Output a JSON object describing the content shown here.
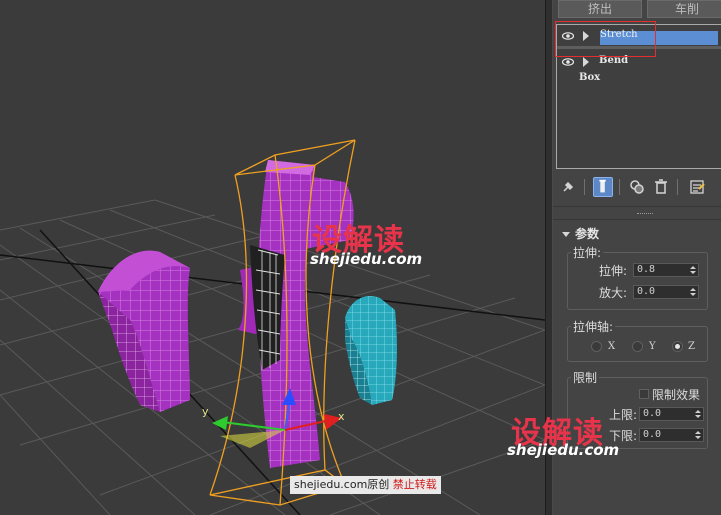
{
  "top_buttons": {
    "extrude": "挤出",
    "lathe": "车削"
  },
  "modifier_stack": {
    "items": [
      {
        "name": "Stretch",
        "selected": true,
        "has_eye": true,
        "has_arrow": true
      },
      {
        "name": "Bend",
        "selected": false,
        "has_eye": true,
        "has_arrow": true
      },
      {
        "name": "Box",
        "selected": false,
        "has_eye": false,
        "has_arrow": false
      }
    ]
  },
  "toolbar": {
    "icons": [
      "pin-stack-icon",
      "show-end-result-icon",
      "make-unique-icon",
      "remove-modifier-icon",
      "configure-modifier-sets-icon"
    ]
  },
  "parameters": {
    "title": "参数",
    "stretch_group": {
      "label": "拉伸:",
      "stretch_label": "拉伸:",
      "stretch_value": "0.8",
      "amplify_label": "放大:",
      "amplify_value": "0.0"
    },
    "axis_group": {
      "label": "拉伸轴:",
      "options": [
        "X",
        "Y",
        "Z"
      ],
      "selected": "Z"
    },
    "limit_group": {
      "label": "限制",
      "limit_effect_label": "限制效果",
      "limit_effect_checked": false,
      "upper_label": "上限:",
      "upper_value": "0.0",
      "lower_label": "下限:",
      "lower_value": "0.0"
    }
  },
  "viewport": {
    "axis_labels": {
      "y": "y",
      "x": "x"
    }
  },
  "watermarks": {
    "cn": "设解读",
    "en": "shejiedu.com",
    "credit_site": "shejiedu.com原创",
    "credit_warning": "禁止转载"
  },
  "colors": {
    "selection_blue": "#5b8ed3",
    "magenta": "#b52ecb",
    "cyan": "#2bb7c7",
    "gizmo_orange": "#f0a020",
    "highlight_red": "#e23030"
  }
}
